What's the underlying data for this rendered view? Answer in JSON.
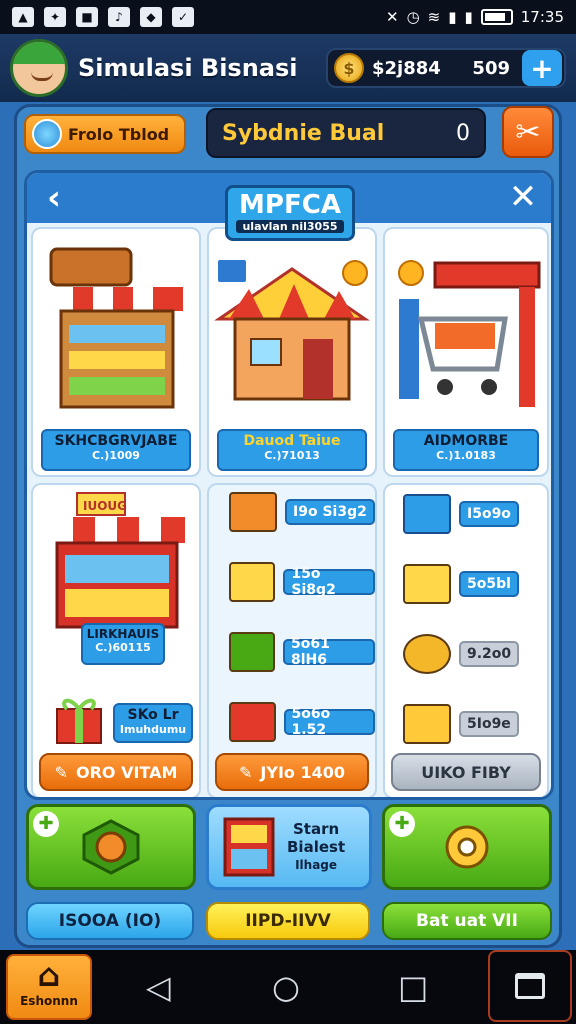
{
  "status_bar": {
    "time": "17:35"
  },
  "header": {
    "title": "Simulasi Bisnasi",
    "coins": "$2j884",
    "gems": "509",
    "plus": "+"
  },
  "topbar": {
    "left_pill": "Frolo Tblod",
    "center_title": "Sybdnie Bual",
    "center_value": "0"
  },
  "shop": {
    "title": "MPFCA",
    "subtitle": "ulavlan nil3055",
    "cards": [
      {
        "name": "SKHCBGRVJABE",
        "price": "C.)1009"
      },
      {
        "name": "Dauod Taiue",
        "price": "C.)71013"
      },
      {
        "name": "AIDMORBE",
        "price": "C.)1.0183"
      }
    ],
    "stall_small": {
      "name": "LIRKHAUIS",
      "price": "C.)60115",
      "sign": "IUOUG"
    },
    "gift_label": {
      "l1": "SKo Lr",
      "l2": "Imuhdumu"
    },
    "items_mid": [
      "I9o Si3g2",
      "15o Si8g2",
      "5o61 8lH6",
      "5o6o 1.52"
    ],
    "items_right": [
      "I5o9o",
      "5o5bl",
      "9.2o0",
      "5Io9e"
    ],
    "btn_orange_1": "ORO VITAM",
    "btn_orange_2": "JYIo 1400",
    "btn_grey": "UIKO FIBY",
    "mid_promo": {
      "l1": "Starn",
      "l2": "Bialest",
      "l3": "Ilhage"
    }
  },
  "bottom_buttons": [
    "ISOOA (IO)",
    "IIPD-IIVV",
    "Bat uat VII"
  ],
  "nav": {
    "home_label": "Eshonnn"
  },
  "colors": {
    "primary_blue": "#2b7ccc",
    "accent_orange": "#f08a12",
    "accent_green": "#48a914",
    "header_dark": "#122a4d"
  }
}
